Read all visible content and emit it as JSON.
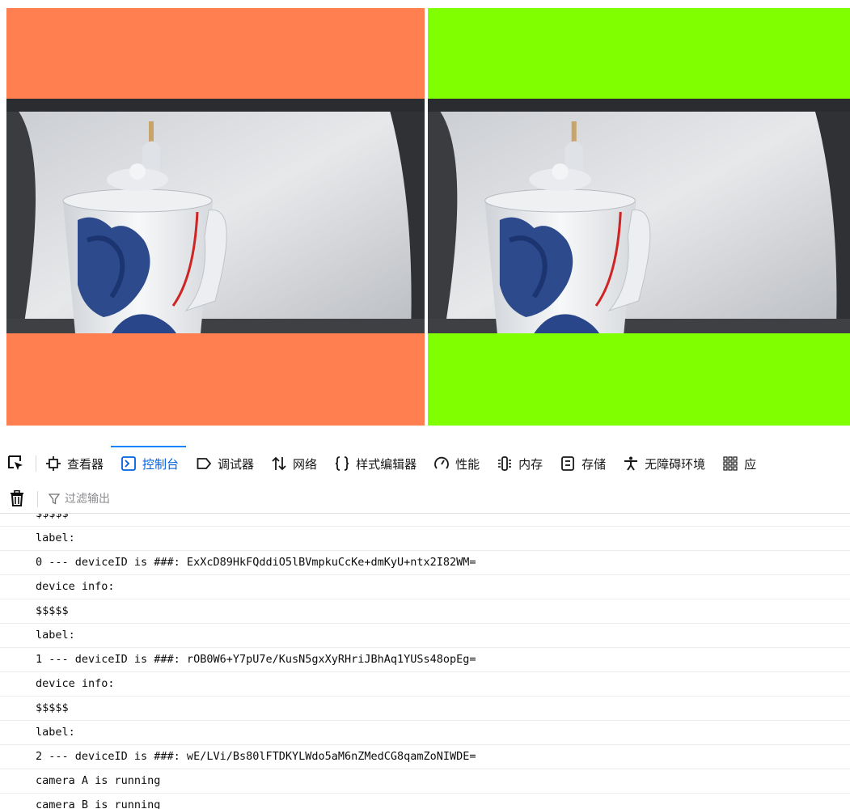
{
  "videos": [
    {
      "name": "panel-a",
      "background": "#ff7f50"
    },
    {
      "name": "panel-b",
      "background": "#80ff00"
    }
  ],
  "toolbar": {
    "tabs": [
      {
        "id": "inspector",
        "label": "查看器",
        "icon": "inspector-icon"
      },
      {
        "id": "console",
        "label": "控制台",
        "icon": "console-icon",
        "active": true
      },
      {
        "id": "debugger",
        "label": "调试器",
        "icon": "debugger-icon"
      },
      {
        "id": "network",
        "label": "网络",
        "icon": "network-icon"
      },
      {
        "id": "style-editor",
        "label": "样式编辑器",
        "icon": "style-editor-icon"
      },
      {
        "id": "performance",
        "label": "性能",
        "icon": "performance-icon"
      },
      {
        "id": "memory",
        "label": "内存",
        "icon": "memory-icon"
      },
      {
        "id": "storage",
        "label": "存储",
        "icon": "storage-icon"
      },
      {
        "id": "accessibility",
        "label": "无障碍环境",
        "icon": "accessibility-icon"
      },
      {
        "id": "application",
        "label": "应",
        "icon": "application-icon"
      }
    ]
  },
  "filter": {
    "placeholder": "过滤输出"
  },
  "console": {
    "lines": [
      "$$$$$",
      "label:",
      "0 --- deviceID is ###: ExXcD89HkFQddiO5lBVmpkuCcKe+dmKyU+ntx2I82WM=",
      "device info:",
      "$$$$$",
      "label:",
      "1 --- deviceID is ###: rOB0W6+Y7pU7e/KusN5gxXyRHriJBhAq1YUSs48opEg=",
      "device info:",
      "$$$$$",
      "label:",
      "2 --- deviceID is ###: wE/LVi/Bs80lFTDKYLWdo5aM6nZMedCG8qamZoNIWDE=",
      "camera A is running",
      "camera B is running"
    ]
  }
}
